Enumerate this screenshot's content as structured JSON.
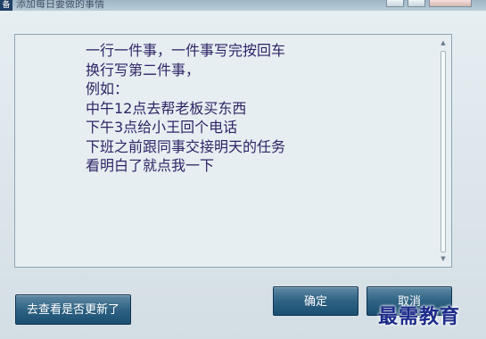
{
  "window": {
    "title": "添加每日要做的事情",
    "icon_glyph": "备"
  },
  "editor": {
    "lines": [
      "一行一件事，一件事写完按回车",
      "换行写第二件事，",
      "例如：",
      "中午12点去帮老板买东西",
      "下午3点给小王回个电话",
      "下班之前跟同事交接明天的任务",
      "看明白了就点我一下"
    ]
  },
  "buttons": {
    "check_update": "去查看是否更新了",
    "ok": "确定",
    "cancel": "取消"
  },
  "watermark": "最需教育",
  "colors": {
    "button_gradient_top": "#5e88a3",
    "button_gradient_bottom": "#1a4f72",
    "text": "#2e2466",
    "watermark": "#1b2a8a"
  }
}
